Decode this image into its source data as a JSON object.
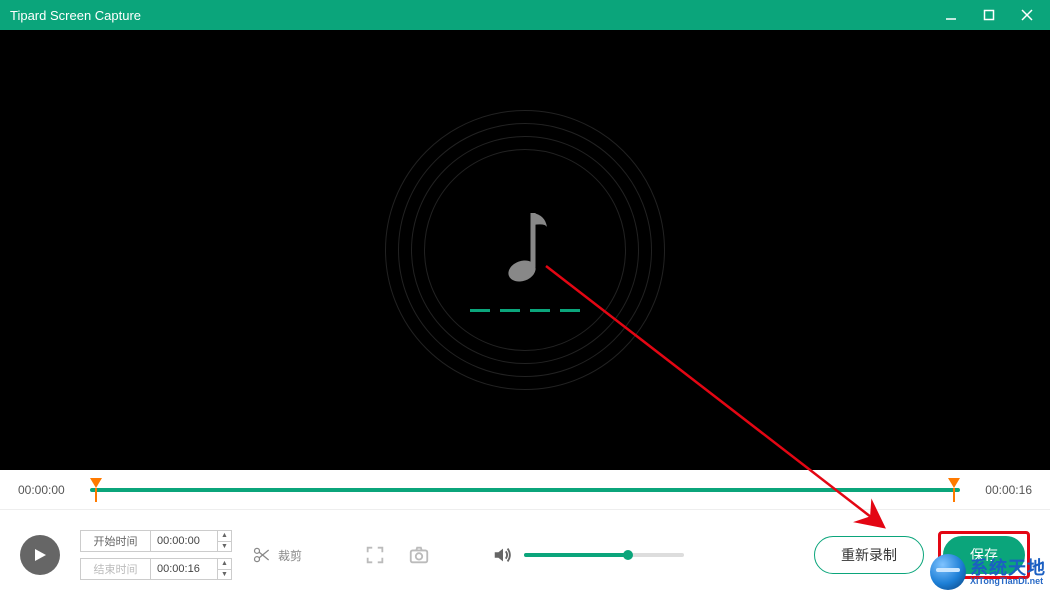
{
  "titlebar": {
    "title": "Tipard Screen Capture"
  },
  "timeline": {
    "start_label": "00:00:00",
    "end_label": "00:00:16",
    "marker_start_pct": 0,
    "marker_end_pct": 100
  },
  "time_fields": {
    "start_label": "开始时间",
    "start_value": "00:00:00",
    "end_label": "结束时间",
    "end_value": "00:00:16"
  },
  "crop": {
    "label": "裁剪"
  },
  "volume": {
    "level_pct": 65
  },
  "buttons": {
    "rerecord": "重新录制",
    "save": "保存"
  },
  "watermark": {
    "cn": "系统天地",
    "en": "XiTongTianDi.net"
  },
  "colors": {
    "accent": "#0ba57b",
    "annotation": "#e30613",
    "marker": "#ff7a00"
  }
}
